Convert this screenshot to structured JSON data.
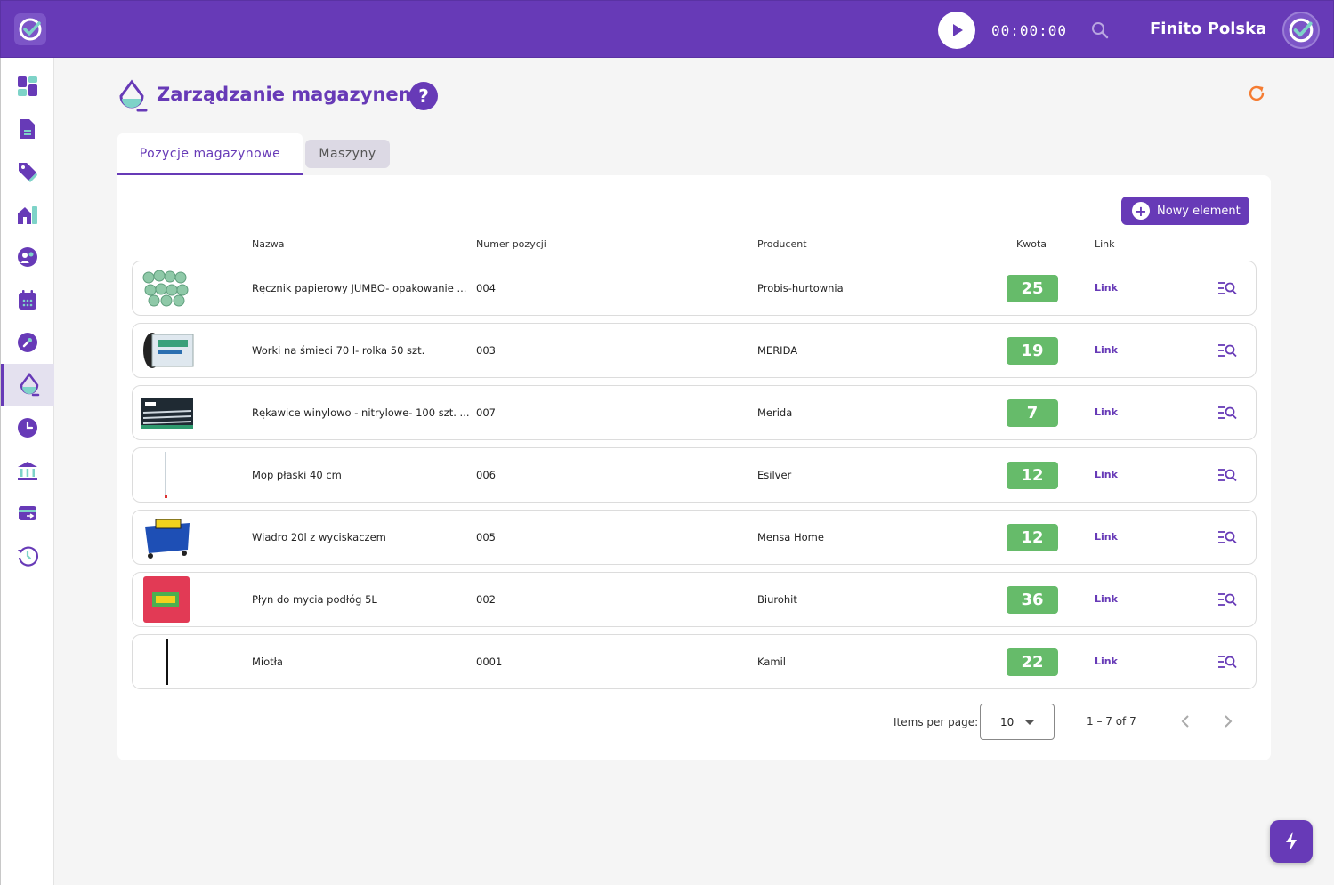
{
  "topbar": {
    "timer": "00:00:00",
    "company": "Finito Polska",
    "icons": [
      "app-logo-icon",
      "play-icon",
      "search-icon",
      "user-avatar-icon"
    ]
  },
  "sidebar": {
    "items": [
      {
        "icon": "dashboard-icon"
      },
      {
        "icon": "document-icon"
      },
      {
        "icon": "tag-icon"
      },
      {
        "icon": "buildings-icon"
      },
      {
        "icon": "people-icon"
      },
      {
        "icon": "calendar-icon"
      },
      {
        "icon": "wrench-icon"
      },
      {
        "icon": "warehouse-icon",
        "active": true
      },
      {
        "icon": "clock-icon"
      },
      {
        "icon": "bank-icon"
      },
      {
        "icon": "payment-card-icon"
      },
      {
        "icon": "history-icon"
      }
    ]
  },
  "page": {
    "title": "Zarządzanie magazynem",
    "help": "?"
  },
  "tabs": [
    {
      "label": "Pozycje magazynowe",
      "active": true
    },
    {
      "label": "Maszyny",
      "active": false
    }
  ],
  "toolbar": {
    "new_label": "Nowy element"
  },
  "table": {
    "columns": {
      "name": "Nazwa",
      "number": "Numer pozycji",
      "producer": "Producent",
      "qty": "Kwota",
      "link": "Link"
    },
    "rows": [
      {
        "name": "Ręcznik papierowy JUMBO- opakowanie ...",
        "number": "004",
        "producer": "Probis-hurtownia",
        "qty": "25",
        "link": "Link",
        "thumb": "paper-towels"
      },
      {
        "name": "Worki na śmieci 70 l- rolka 50 szt.",
        "number": "003",
        "producer": "MERIDA",
        "qty": "19",
        "link": "Link",
        "thumb": "trash-bags"
      },
      {
        "name": "Rękawice winylowo - nitrylowe- 100 szt. ...",
        "number": "007",
        "producer": "Merida",
        "qty": "7",
        "link": "Link",
        "thumb": "gloves"
      },
      {
        "name": "Mop płaski 40 cm",
        "number": "006",
        "producer": "Esilver",
        "qty": "12",
        "link": "Link",
        "thumb": "mop"
      },
      {
        "name": "Wiadro 20l z wyciskaczem",
        "number": "005",
        "producer": "Mensa Home",
        "qty": "12",
        "link": "Link",
        "thumb": "bucket"
      },
      {
        "name": "Płyn do mycia podłóg 5L",
        "number": "002",
        "producer": "Biurohit",
        "qty": "36",
        "link": "Link",
        "thumb": "floor-cleaner"
      },
      {
        "name": "Miotła",
        "number": "0001",
        "producer": "Kamil",
        "qty": "22",
        "link": "Link",
        "thumb": "broom"
      }
    ]
  },
  "paginator": {
    "label": "Items per page:",
    "per_page": "10",
    "range": "1 – 7 of 7"
  },
  "colors": {
    "primary": "#673ab7",
    "qty_badge": "#66bb6a",
    "refresh": "#f57c32"
  }
}
